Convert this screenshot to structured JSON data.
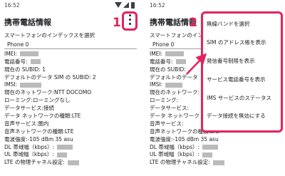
{
  "status_bar": {
    "time": "16:52"
  },
  "app": {
    "title": "携帯電話情報"
  },
  "steps": {
    "one": "1",
    "two": "2"
  },
  "select_label": "スマートフォンのインデックスを選択",
  "phone_select_value": "Phone 0",
  "left_fields": [
    {
      "label": "IMEI:",
      "value": ""
    },
    {
      "label": "電話番号:",
      "value": ""
    },
    {
      "label": "現在の SUBID:",
      "value": "1"
    },
    {
      "label": "デフォルトのデータ SIM の SUBID:",
      "value": "2"
    },
    {
      "label": "IMSI:",
      "value": ""
    },
    {
      "label": "現在のネットワーク:",
      "value": "NTT DOCOMO"
    },
    {
      "label": "ローミング:",
      "value": "ローミングなし"
    },
    {
      "label": "データサービス:",
      "value": "接続"
    },
    {
      "label": "データ ネットワークの種類:",
      "value": "LTE"
    },
    {
      "label": "音声サービス:",
      "value": "圏内"
    },
    {
      "label": "音声ネットワークの種類:",
      "value": "LTE"
    },
    {
      "label": "電波強度:",
      "value": "-105 dBm   35 asu"
    },
    {
      "label": "DL 帯域幅（kbps）:",
      "value": ""
    },
    {
      "label": "UL 帯域幅（kbps）:",
      "value": ""
    },
    {
      "label": "LTE の物理チャネル設定:",
      "value": ""
    }
  ],
  "right_fields": [
    {
      "label": "IMEI:",
      "value": ""
    },
    {
      "label": "電話番号:",
      "value": ""
    },
    {
      "label": "現在の SUBID:",
      "value": ""
    },
    {
      "label": "デフォルトのデータ",
      "value": ""
    },
    {
      "label": "IMSI:",
      "value": ""
    },
    {
      "label": "現在のネットワーク:",
      "value": ""
    },
    {
      "label": "ローミング:",
      "value": ""
    },
    {
      "label": "データサービス:",
      "value": ""
    },
    {
      "label": "データ ネットワーク",
      "value": ""
    },
    {
      "label": "音声サービス:",
      "value": ""
    },
    {
      "label": "音声ネットワークの種類:",
      "value": "LTE"
    },
    {
      "label": "電波強度:",
      "value": "-105 dBm   35 asu"
    },
    {
      "label": "DL 帯域幅（kbps）:",
      "value": ""
    },
    {
      "label": "UL 帯域幅（kbps）:",
      "value": ""
    },
    {
      "label": "LTE の物理チャネル設定:",
      "value": ""
    }
  ],
  "menu": {
    "items": [
      "無線バンドを選択",
      "SIM のアドレス帳を表示",
      "発信番号制限を表示",
      "サービス電話番号を表示",
      "IMS サービスのステータス",
      "データ接続を無効にする"
    ]
  },
  "colors": {
    "accent": "#e0245e",
    "text": "#202124"
  },
  "icons": {
    "overflow": "more-vert-icon",
    "wifi": "wifi-icon",
    "signal": "signal-icon",
    "battery": "battery-icon"
  }
}
